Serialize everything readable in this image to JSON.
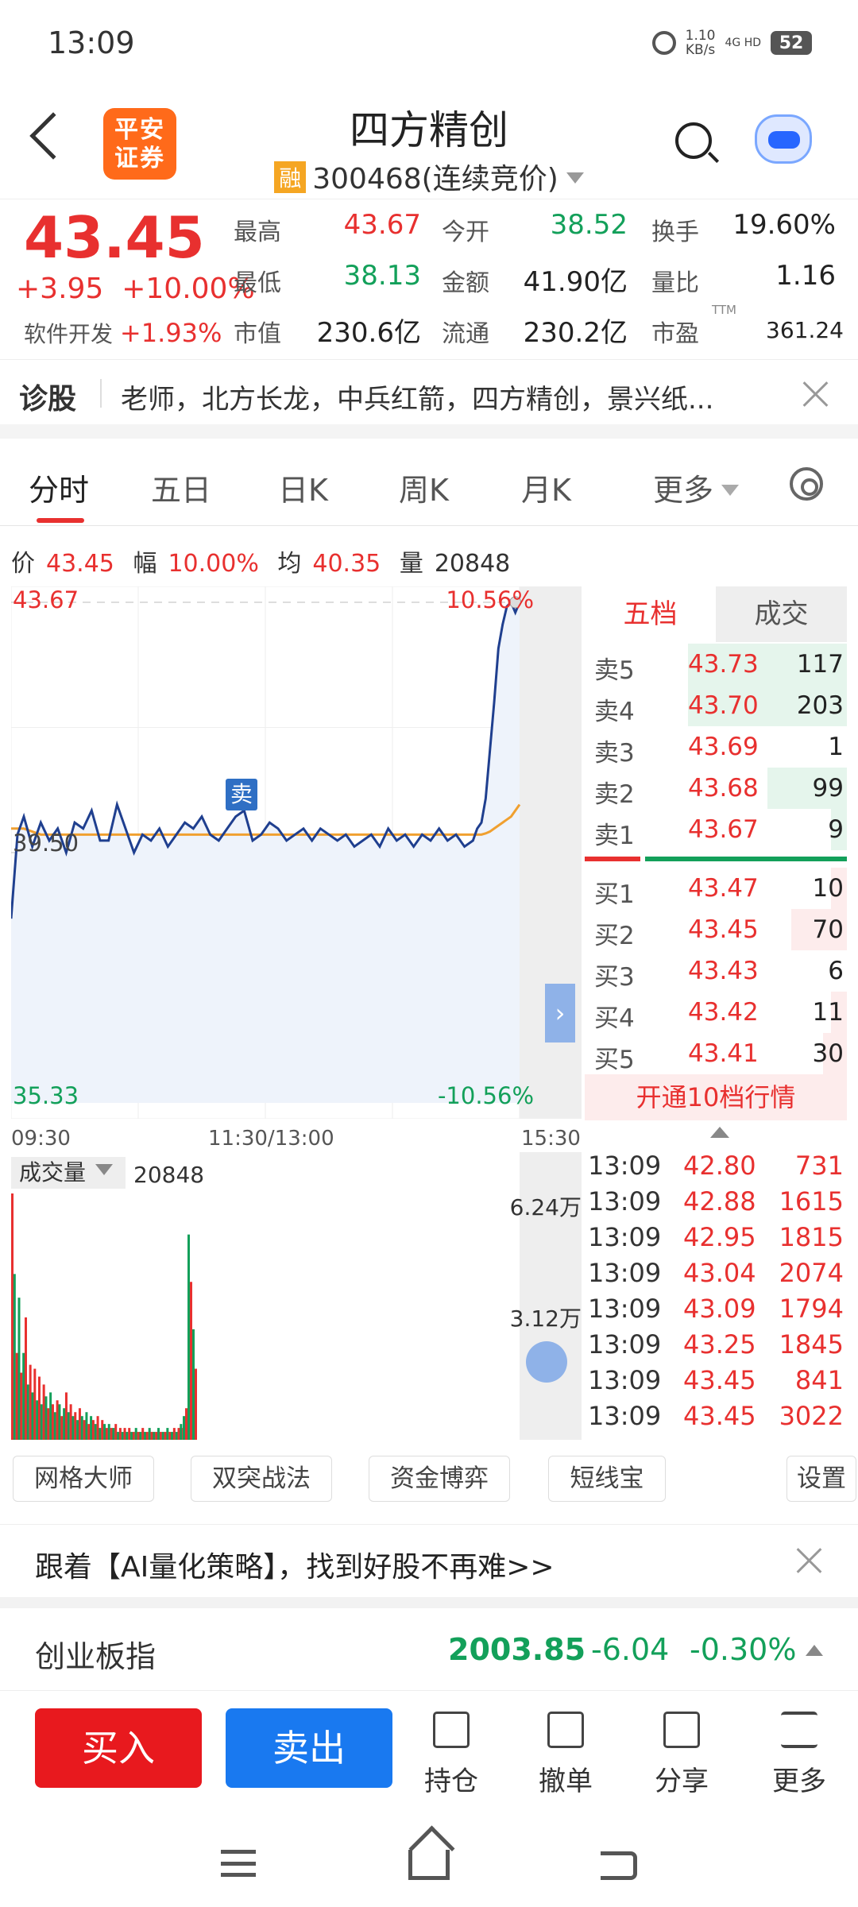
{
  "status_bar": {
    "time": "13:09",
    "net_speed_value": "1.10",
    "net_speed_unit": "KB/s",
    "signal": "4G HD",
    "battery": "52"
  },
  "header": {
    "logo_text": "平安证券",
    "stock_name": "四方精创",
    "margin_badge": "融",
    "stock_code": "300468",
    "session": "(连续竞价)"
  },
  "quote": {
    "price": "43.45",
    "change": "+3.95",
    "change_pct": "+10.00%",
    "sector_name": "软件开发",
    "sector_pct": "+1.93%",
    "fields": [
      {
        "label": "最高",
        "value": "43.67",
        "color": "red"
      },
      {
        "label": "今开",
        "value": "38.52",
        "color": "green"
      },
      {
        "label": "换手",
        "value": "19.60%",
        "color": "dark"
      },
      {
        "label": "最低",
        "value": "38.13",
        "color": "green"
      },
      {
        "label": "金额",
        "value": "41.90亿",
        "color": "dark"
      },
      {
        "label": "量比",
        "value": "1.16",
        "color": "dark"
      },
      {
        "label": "市值",
        "value": "230.6亿",
        "color": "dark"
      },
      {
        "label": "流通",
        "value": "230.2亿",
        "color": "dark"
      },
      {
        "label": "市盈",
        "value": "361.24",
        "color": "dark"
      }
    ],
    "pe_superscript": "TTM"
  },
  "diagnosis": {
    "label": "诊股",
    "text": "老师，北方长龙，中兵红箭，四方精创，景兴纸..."
  },
  "tabs": [
    "分时",
    "五日",
    "日K",
    "周K",
    "月K",
    "更多"
  ],
  "active_tab": 0,
  "price_info": {
    "price_label": "价",
    "price": "43.45",
    "amp_label": "幅",
    "amp": "10.00%",
    "avg_label": "均",
    "avg": "40.35",
    "vol_label": "量",
    "vol": "20848"
  },
  "chart_data": {
    "type": "line",
    "title": "",
    "xlabel": "",
    "ylabel": "",
    "x_ticks": [
      "09:30",
      "11:30/13:00",
      "15:30"
    ],
    "y_ticks_left": [
      "43.67",
      "39.50",
      "35.33"
    ],
    "y_ticks_right": [
      "10.56%",
      "-10.56%"
    ],
    "ylim": [
      35.33,
      43.67
    ],
    "prev_close": 39.5,
    "x": [
      0,
      3,
      6,
      10,
      14,
      18,
      22,
      26,
      30,
      34,
      38,
      42,
      46,
      50,
      54,
      58,
      62,
      66,
      70,
      74,
      78,
      82,
      86,
      90,
      94,
      98,
      102,
      106,
      110,
      114,
      118,
      122,
      126,
      130,
      134,
      138,
      142,
      146,
      150,
      154,
      158,
      162,
      166,
      170,
      174,
      178,
      182,
      186,
      190,
      194,
      198,
      202,
      206,
      210,
      214,
      218,
      220,
      222,
      224,
      226,
      228,
      230,
      232,
      234,
      236,
      238,
      240
    ],
    "series": [
      {
        "name": "price",
        "color": "#1f3f8f",
        "values": [
          38.4,
          39.8,
          40.1,
          39.6,
          40.0,
          39.7,
          39.9,
          39.5,
          40.0,
          39.9,
          40.2,
          39.7,
          39.7,
          40.3,
          39.9,
          39.5,
          39.8,
          39.7,
          39.9,
          39.6,
          39.8,
          40.0,
          39.9,
          40.1,
          39.8,
          39.7,
          39.9,
          40.1,
          40.2,
          39.7,
          39.8,
          40.0,
          39.9,
          39.7,
          39.8,
          39.9,
          39.7,
          39.9,
          39.8,
          39.7,
          39.8,
          39.6,
          39.7,
          39.8,
          39.6,
          39.9,
          39.7,
          39.8,
          39.6,
          39.8,
          39.7,
          39.9,
          39.7,
          39.8,
          39.6,
          39.7,
          39.9,
          40.0,
          40.4,
          41.2,
          42.0,
          42.9,
          43.3,
          43.6,
          43.67,
          43.5,
          43.67
        ]
      },
      {
        "name": "avg",
        "color": "#f0a030",
        "values": [
          39.9,
          39.9,
          39.9,
          39.85,
          39.8,
          39.8,
          39.8,
          39.8,
          39.8,
          39.8,
          39.8,
          39.8,
          39.8,
          39.8,
          39.8,
          39.8,
          39.8,
          39.8,
          39.8,
          39.8,
          39.8,
          39.8,
          39.8,
          39.8,
          39.8,
          39.8,
          39.8,
          39.8,
          39.8,
          39.8,
          39.8,
          39.8,
          39.8,
          39.8,
          39.8,
          39.8,
          39.8,
          39.8,
          39.8,
          39.8,
          39.8,
          39.8,
          39.8,
          39.8,
          39.8,
          39.8,
          39.8,
          39.8,
          39.8,
          39.8,
          39.8,
          39.8,
          39.8,
          39.8,
          39.8,
          39.8,
          39.8,
          39.8,
          39.82,
          39.85,
          39.9,
          39.95,
          40.0,
          40.05,
          40.1,
          40.2,
          40.3
        ]
      }
    ],
    "marker_label": "卖",
    "expand_icon": "chevron-right-icon"
  },
  "order_book": {
    "tab_five": "五档",
    "tab_trades": "成交",
    "asks": [
      {
        "label": "卖5",
        "price": "43.73",
        "vol": "117",
        "bar": 1.0
      },
      {
        "label": "卖4",
        "price": "43.70",
        "vol": "203",
        "bar": 1.0
      },
      {
        "label": "卖3",
        "price": "43.69",
        "vol": "1",
        "bar": 0.0
      },
      {
        "label": "卖2",
        "price": "43.68",
        "vol": "99",
        "bar": 0.5
      },
      {
        "label": "卖1",
        "price": "43.67",
        "vol": "9",
        "bar": 0.1
      }
    ],
    "bids": [
      {
        "label": "买1",
        "price": "43.47",
        "vol": "10",
        "bar": 0.1
      },
      {
        "label": "买2",
        "price": "43.45",
        "vol": "70",
        "bar": 0.35
      },
      {
        "label": "买3",
        "price": "43.43",
        "vol": "6",
        "bar": 0.0
      },
      {
        "label": "买4",
        "price": "43.42",
        "vol": "11",
        "bar": 0.1
      },
      {
        "label": "买5",
        "price": "43.41",
        "vol": "30",
        "bar": 0.15
      }
    ],
    "open_ten": "开通10档行情"
  },
  "volume": {
    "label": "成交量",
    "value": "20848",
    "tick_high": "6.24万",
    "tick_mid": "3.12万",
    "ylim": [
      0,
      62400
    ],
    "bars": [
      62400,
      42000,
      22000,
      36000,
      17000,
      22000,
      31000,
      14000,
      19000,
      12000,
      18000,
      10000,
      16000,
      9000,
      14000,
      11000,
      8000,
      12000,
      9000,
      7000,
      10000,
      9000,
      6000,
      8000,
      12000,
      7000,
      9000,
      6000,
      7000,
      5000,
      8000,
      6000,
      5000,
      7000,
      4000,
      6000,
      5000,
      4000,
      6000,
      3000,
      5000,
      4000,
      3000,
      4000,
      3000,
      3000,
      4000,
      2000,
      3000,
      2000,
      3000,
      2000,
      3000,
      2000,
      2000,
      3000,
      2000,
      2000,
      3000,
      2000,
      2000,
      3000,
      2000,
      2000,
      2000,
      3000,
      2000,
      2000,
      2000,
      3000,
      2000,
      2000,
      3000,
      2000,
      3000,
      4000,
      3000,
      6000,
      8000,
      52000,
      40000,
      28000,
      18000
    ],
    "colors": "alternating red/green"
  },
  "trades": {
    "rows": [
      {
        "time": "13:09",
        "price": "42.80",
        "vol": "731"
      },
      {
        "time": "13:09",
        "price": "42.88",
        "vol": "1615"
      },
      {
        "time": "13:09",
        "price": "42.95",
        "vol": "1815"
      },
      {
        "time": "13:09",
        "price": "43.04",
        "vol": "2074"
      },
      {
        "time": "13:09",
        "price": "43.09",
        "vol": "1794"
      },
      {
        "time": "13:09",
        "price": "43.25",
        "vol": "1845"
      },
      {
        "time": "13:09",
        "price": "43.45",
        "vol": "841"
      },
      {
        "time": "13:09",
        "price": "43.45",
        "vol": "3022"
      }
    ]
  },
  "tools": [
    "网格大师",
    "双突战法",
    "资金博弈",
    "短线宝",
    "设置"
  ],
  "banner": {
    "text": "跟着【AI量化策略】，找到好股不再难>>"
  },
  "index": {
    "name": "创业板指",
    "value": "2003.85",
    "change": "-6.04",
    "pct": "-0.30%"
  },
  "actions": {
    "buy": "买入",
    "sell": "卖出",
    "position": "持仓",
    "cancel": "撤单",
    "share": "分享",
    "more": "更多"
  },
  "colors": {
    "red": "#e8302f",
    "green": "#13a05a",
    "blue": "#1979f0",
    "brand_orange": "#ff6a1a"
  }
}
